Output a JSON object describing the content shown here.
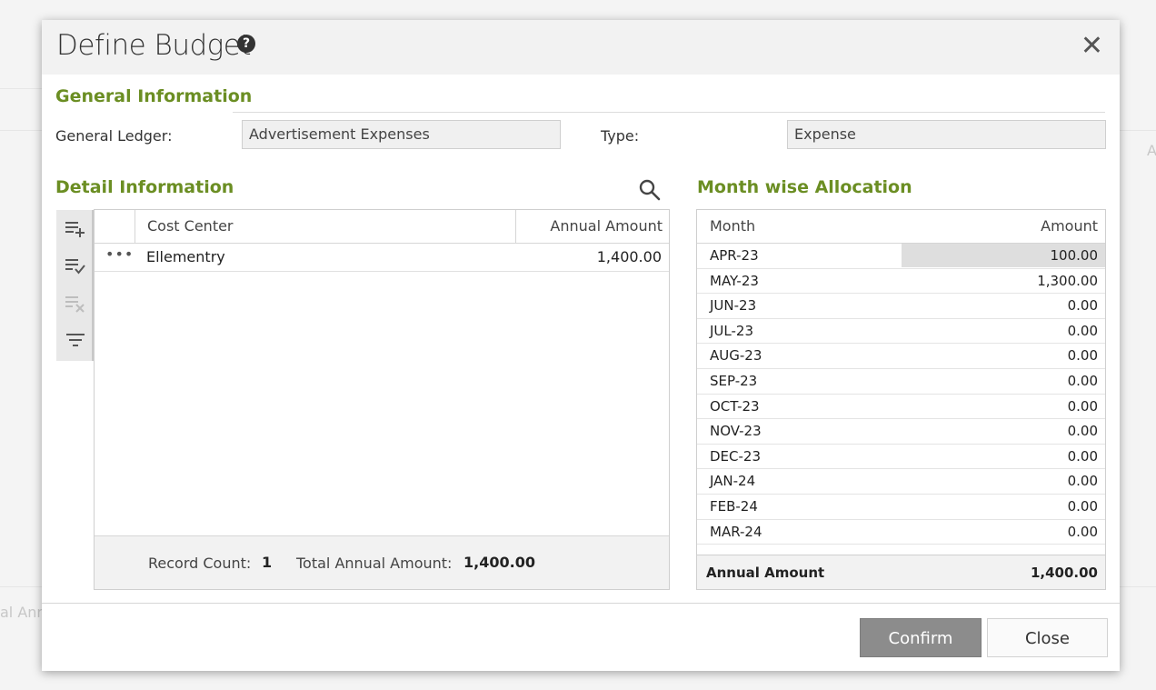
{
  "dialog": {
    "title": "Define Budget",
    "help_glyph": "?",
    "close_glyph": "✕"
  },
  "general_info": {
    "title": "General Information",
    "ledger_label": "General Ledger:",
    "ledger_value": "Advertisement Expenses",
    "type_label": "Type:",
    "type_value": "Expense"
  },
  "detail_info": {
    "title": "Detail Information",
    "columns": {
      "cost_center": "Cost Center",
      "annual_amount": "Annual Amount"
    },
    "rows": [
      {
        "menu": "•••",
        "cost_center": "Ellementry",
        "annual_amount": "1,400.00"
      }
    ],
    "footer": {
      "record_count_label": "Record Count:",
      "record_count": "1",
      "total_label": "Total Annual Amount:",
      "total": "1,400.00"
    }
  },
  "month_alloc": {
    "title": "Month wise Allocation",
    "columns": {
      "month": "Month",
      "amount": "Amount"
    },
    "rows": [
      {
        "month": "APR-23",
        "amount": "100.00"
      },
      {
        "month": "MAY-23",
        "amount": "1,300.00"
      },
      {
        "month": "JUN-23",
        "amount": "0.00"
      },
      {
        "month": "JUL-23",
        "amount": "0.00"
      },
      {
        "month": "AUG-23",
        "amount": "0.00"
      },
      {
        "month": "SEP-23",
        "amount": "0.00"
      },
      {
        "month": "OCT-23",
        "amount": "0.00"
      },
      {
        "month": "NOV-23",
        "amount": "0.00"
      },
      {
        "month": "DEC-23",
        "amount": "0.00"
      },
      {
        "month": "JAN-24",
        "amount": "0.00"
      },
      {
        "month": "FEB-24",
        "amount": "0.00"
      },
      {
        "month": "MAR-24",
        "amount": "0.00"
      }
    ],
    "footer": {
      "label": "Annual Amount",
      "value": "1,400.00"
    }
  },
  "buttons": {
    "confirm": "Confirm",
    "close": "Close"
  },
  "background": {
    "text_left": "al Ann",
    "text_right": "A"
  },
  "colors": {
    "section_title": "#6b8e23",
    "confirm_bg": "#8c8c8c"
  }
}
